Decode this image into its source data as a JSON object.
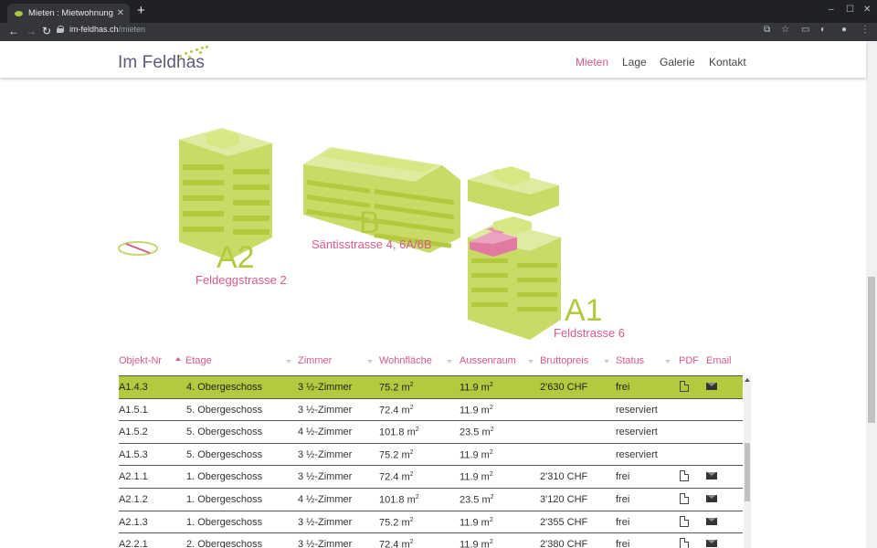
{
  "browser": {
    "tab_title": "Mieten : Mietwohnungen",
    "new_tab": "+",
    "url_host": "im-feldhas.ch",
    "url_path": "/mieten"
  },
  "site": {
    "logo": "Im Feldhas",
    "nav": [
      {
        "label": "Mieten",
        "active": true
      },
      {
        "label": "Lage",
        "active": false
      },
      {
        "label": "Galerie",
        "active": false
      },
      {
        "label": "Kontakt",
        "active": false
      }
    ]
  },
  "plan": {
    "buildings": [
      {
        "id": "A2",
        "street": "Feldeggstrasse 2"
      },
      {
        "id": "B",
        "street": "Säntisstrasse 4, 6A/6B"
      },
      {
        "id": "A1",
        "street": "Feldstrasse 6"
      }
    ],
    "colors": {
      "building": "#d2e07c",
      "building_shade": "#b5c93e",
      "highlight": "#e07aa0",
      "accent": "#d55a8e"
    }
  },
  "table": {
    "headers": [
      "Objekt-Nr",
      "Etage",
      "Zimmer",
      "Wohnfläche",
      "Aussenraum",
      "Bruttopreis",
      "Status",
      "PDF",
      "Email"
    ],
    "rows": [
      {
        "nr": "A1.4.3",
        "etage": "4. Obergeschoss",
        "zimmer": "3 ½-Zimmer",
        "flaeche": "75.2 m",
        "aussen": "11.9 m",
        "preis": "2'630 CHF",
        "status": "frei",
        "pdf": true,
        "email": true,
        "selected": true
      },
      {
        "nr": "A1.5.1",
        "etage": "5. Obergeschoss",
        "zimmer": "3 ½-Zimmer",
        "flaeche": "72.4 m",
        "aussen": "11.9 m",
        "preis": "",
        "status": "reserviert",
        "pdf": false,
        "email": false,
        "selected": false
      },
      {
        "nr": "A1.5.2",
        "etage": "5. Obergeschoss",
        "zimmer": "4 ½-Zimmer",
        "flaeche": "101.8 m",
        "aussen": "23.5 m",
        "preis": "",
        "status": "reserviert",
        "pdf": false,
        "email": false,
        "selected": false
      },
      {
        "nr": "A1.5.3",
        "etage": "5. Obergeschoss",
        "zimmer": "3 ½-Zimmer",
        "flaeche": "75.2 m",
        "aussen": "11.9 m",
        "preis": "",
        "status": "reserviert",
        "pdf": false,
        "email": false,
        "selected": false
      },
      {
        "nr": "A2.1.1",
        "etage": "1. Obergeschoss",
        "zimmer": "3 ½-Zimmer",
        "flaeche": "72.4 m",
        "aussen": "11.9 m",
        "preis": "2'310 CHF",
        "status": "frei",
        "pdf": true,
        "email": true,
        "selected": false
      },
      {
        "nr": "A2.1.2",
        "etage": "1. Obergeschoss",
        "zimmer": "4 ½-Zimmer",
        "flaeche": "101.8 m",
        "aussen": "23.5 m",
        "preis": "3'120 CHF",
        "status": "frei",
        "pdf": true,
        "email": true,
        "selected": false
      },
      {
        "nr": "A2.1.3",
        "etage": "1. Obergeschoss",
        "zimmer": "3 ½-Zimmer",
        "flaeche": "75.2 m",
        "aussen": "11.9 m",
        "preis": "2'355 CHF",
        "status": "frei",
        "pdf": true,
        "email": true,
        "selected": false
      },
      {
        "nr": "A2.2.1",
        "etage": "2. Obergeschoss",
        "zimmer": "3 ½-Zimmer",
        "flaeche": "72.4 m",
        "aussen": "11.9 m",
        "preis": "2'380 CHF",
        "status": "frei",
        "pdf": true,
        "email": true,
        "selected": false
      }
    ],
    "unit_sup": "2"
  }
}
